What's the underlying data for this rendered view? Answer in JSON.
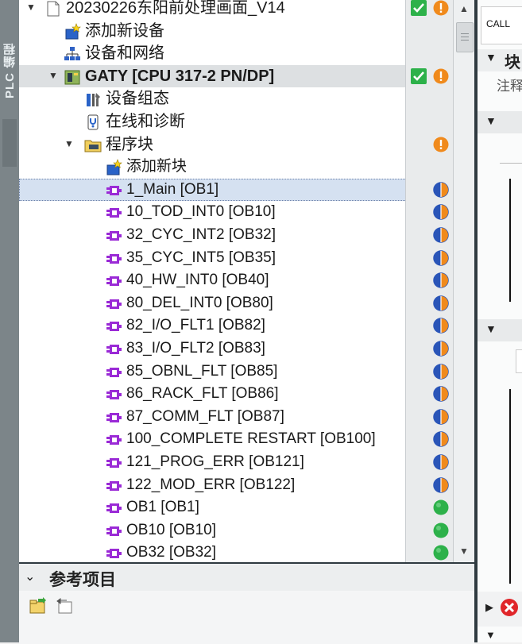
{
  "left_strip": {
    "label": "PLC 编程"
  },
  "tree": {
    "items": [
      {
        "label": "20230226东阳前处理画面_V14",
        "indent": 0,
        "twisty": "open",
        "icon": "project-icon",
        "status": [
          "check",
          "warn"
        ]
      },
      {
        "label": "添加新设备",
        "indent": 1,
        "twisty": "",
        "icon": "add-device-icon",
        "status": []
      },
      {
        "label": "设备和网络",
        "indent": 1,
        "twisty": "",
        "icon": "network-icon",
        "status": []
      },
      {
        "label": "GATY [CPU 317-2 PN/DP]",
        "indent": 1,
        "twisty": "open",
        "icon": "plc-icon",
        "status": [
          "check",
          "warn"
        ],
        "bold": true,
        "gray": true
      },
      {
        "label": "设备组态",
        "indent": 2,
        "twisty": "",
        "icon": "device-config-icon",
        "status": []
      },
      {
        "label": "在线和诊断",
        "indent": 2,
        "twisty": "",
        "icon": "online-diagnostics-icon",
        "status": []
      },
      {
        "label": "程序块",
        "indent": 2,
        "twisty": "open",
        "icon": "folder-icon",
        "status": [
          "warn"
        ]
      },
      {
        "label": "添加新块",
        "indent": 3,
        "twisty": "",
        "icon": "add-block-icon",
        "status": []
      },
      {
        "label": "1_Main [OB1]",
        "indent": 3,
        "twisty": "",
        "icon": "ob-block-icon",
        "status": [
          "half"
        ],
        "selected": true
      },
      {
        "label": "10_TOD_INT0 [OB10]",
        "indent": 3,
        "twisty": "",
        "icon": "ob-block-icon",
        "status": [
          "half"
        ]
      },
      {
        "label": "32_CYC_INT2 [OB32]",
        "indent": 3,
        "twisty": "",
        "icon": "ob-block-icon",
        "status": [
          "half"
        ]
      },
      {
        "label": "35_CYC_INT5 [OB35]",
        "indent": 3,
        "twisty": "",
        "icon": "ob-block-icon",
        "status": [
          "half"
        ]
      },
      {
        "label": "40_HW_INT0 [OB40]",
        "indent": 3,
        "twisty": "",
        "icon": "ob-block-icon",
        "status": [
          "half"
        ]
      },
      {
        "label": "80_DEL_INT0 [OB80]",
        "indent": 3,
        "twisty": "",
        "icon": "ob-block-icon",
        "status": [
          "half"
        ]
      },
      {
        "label": "82_I/O_FLT1 [OB82]",
        "indent": 3,
        "twisty": "",
        "icon": "ob-block-icon",
        "status": [
          "half"
        ]
      },
      {
        "label": "83_I/O_FLT2 [OB83]",
        "indent": 3,
        "twisty": "",
        "icon": "ob-block-icon",
        "status": [
          "half"
        ]
      },
      {
        "label": "85_OBNL_FLT [OB85]",
        "indent": 3,
        "twisty": "",
        "icon": "ob-block-icon",
        "status": [
          "half"
        ]
      },
      {
        "label": "86_RACK_FLT [OB86]",
        "indent": 3,
        "twisty": "",
        "icon": "ob-block-icon",
        "status": [
          "half"
        ]
      },
      {
        "label": "87_COMM_FLT [OB87]",
        "indent": 3,
        "twisty": "",
        "icon": "ob-block-icon",
        "status": [
          "half"
        ]
      },
      {
        "label": "100_COMPLETE RESTART [OB100]",
        "indent": 3,
        "twisty": "",
        "icon": "ob-block-icon",
        "status": [
          "half"
        ]
      },
      {
        "label": "121_PROG_ERR [OB121]",
        "indent": 3,
        "twisty": "",
        "icon": "ob-block-icon",
        "status": [
          "half"
        ]
      },
      {
        "label": "122_MOD_ERR [OB122]",
        "indent": 3,
        "twisty": "",
        "icon": "ob-block-icon",
        "status": [
          "half"
        ]
      },
      {
        "label": "OB1 [OB1]",
        "indent": 3,
        "twisty": "",
        "icon": "ob-block-icon",
        "status": [
          "green"
        ]
      },
      {
        "label": "OB10 [OB10]",
        "indent": 3,
        "twisty": "",
        "icon": "ob-block-icon",
        "status": [
          "green"
        ]
      },
      {
        "label": "OB32 [OB32]",
        "indent": 3,
        "twisty": "",
        "icon": "ob-block-icon",
        "status": [
          "green"
        ]
      }
    ]
  },
  "reference_panel": {
    "title": "参考项目"
  },
  "right_pane": {
    "call_label": "CALL",
    "block_label": "块",
    "comment_label": "注释"
  },
  "colors": {
    "block_icon": "#9a2ad6",
    "ok_green": "#2db14a",
    "warn_orange": "#f08a1c",
    "half_blue": "#2a55b8",
    "error_red": "#e0262a",
    "selection": "#d5e1f1"
  }
}
